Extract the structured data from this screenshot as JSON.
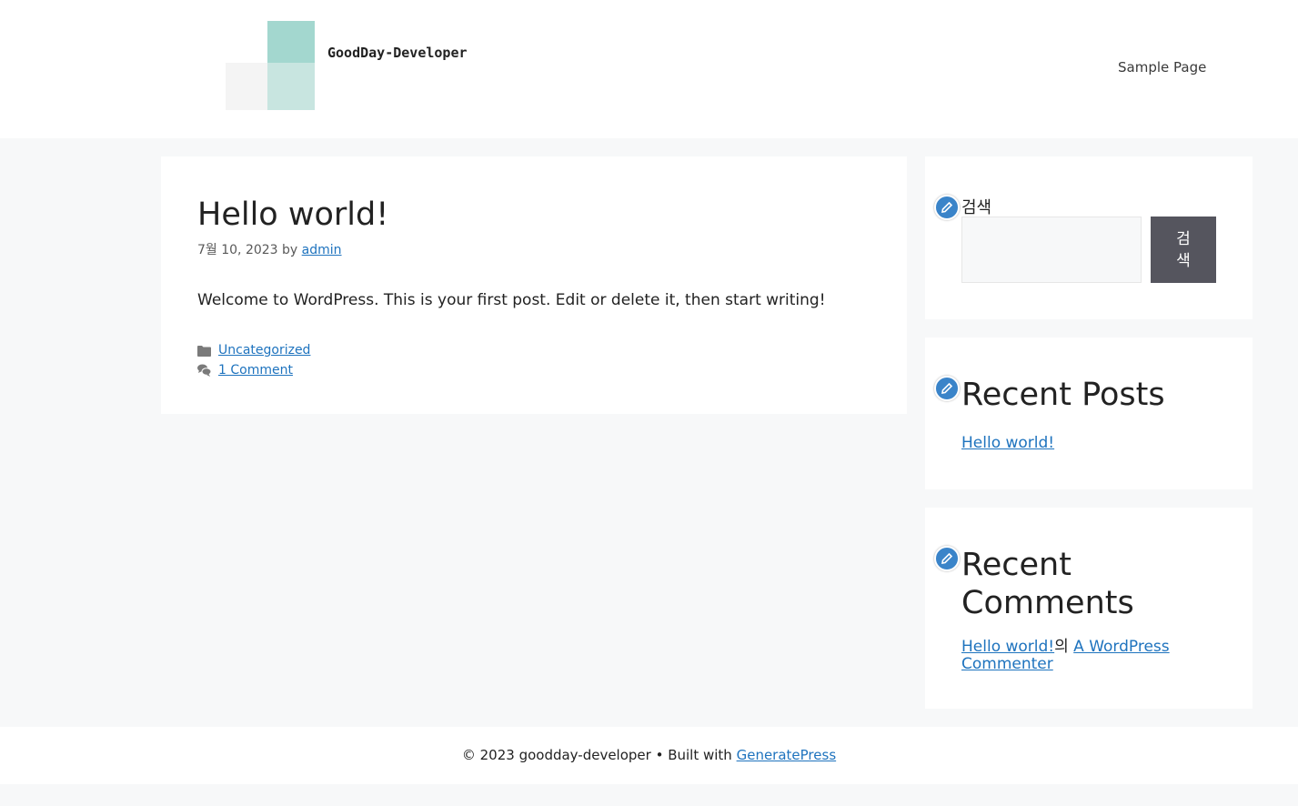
{
  "header": {
    "site_title": "GoodDay-Developer",
    "nav": [
      {
        "label": "Sample Page"
      }
    ]
  },
  "post": {
    "title": "Hello world!",
    "date": "7월 10, 2023",
    "by": "by",
    "author": "admin",
    "content": "Welcome to WordPress. This is your first post. Edit or delete it, then start writing!",
    "category": "Uncategorized",
    "comments_link": "1 Comment"
  },
  "sidebar": {
    "search": {
      "title": "검색",
      "input_value": "",
      "button_label": "검색"
    },
    "recent_posts": {
      "title": "Recent Posts",
      "items": [
        "Hello world!"
      ]
    },
    "recent_comments": {
      "title": "Recent Comments",
      "post_link": "Hello world!",
      "connector": "의",
      "author_link": "A WordPress Commenter"
    }
  },
  "footer": {
    "copyright": "© 2023 goodday-developer • Built with",
    "link": "GeneratePress"
  },
  "colors": {
    "accent": "#1e73be",
    "logo_dark": "#a3d7cf",
    "logo_light": "#c8e5e0",
    "search_button": "#55555e",
    "edit_badge": "#3a84c9"
  },
  "icons": {
    "category": "folder-icon",
    "comments": "comments-icon",
    "edit": "pencil-icon"
  }
}
